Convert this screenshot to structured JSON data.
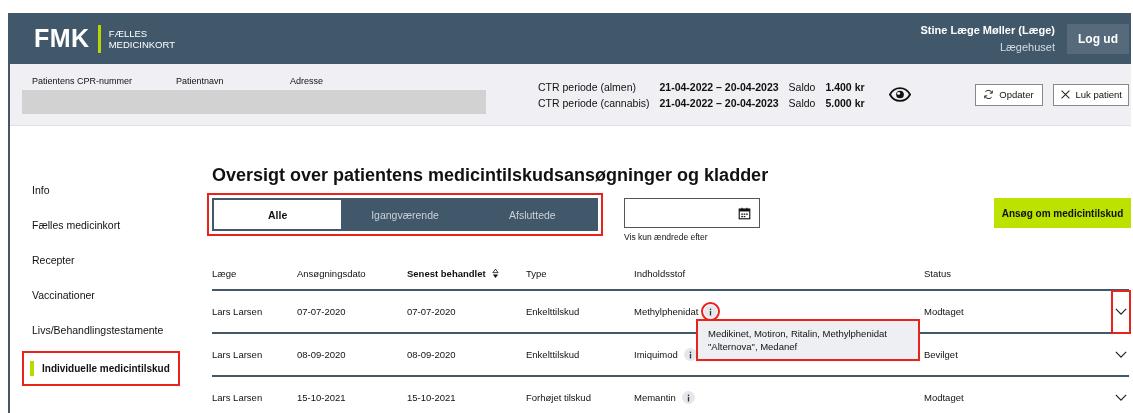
{
  "header": {
    "logo": "FMK",
    "subtitle_lines": [
      "FÆLLES",
      "MEDICINKORT"
    ],
    "user_name": "Stine Læge Møller (Læge)",
    "user_org": "Lægehuset",
    "logout": "Log ud"
  },
  "patient": {
    "labels": [
      "Patientens CPR-nummer",
      "Patientnavn",
      "Adresse"
    ],
    "periods": [
      {
        "label": "CTR periode (almen)",
        "period": "21-04-2022 – 20-04-2023",
        "saldo_label": "Saldo",
        "amount": "1.400 kr"
      },
      {
        "label": "CTR periode (cannabis)",
        "period": "21-04-2022 – 20-04-2023",
        "saldo_label": "Saldo",
        "amount": "5.000 kr"
      }
    ],
    "buttons": [
      {
        "kind": "refresh",
        "label": "Opdater"
      },
      {
        "kind": "close",
        "label": "Luk patient"
      }
    ]
  },
  "sidebar": {
    "items": [
      {
        "label": "Info",
        "selected": false,
        "annotated": false
      },
      {
        "label": "Fælles medicinkort",
        "selected": false,
        "annotated": false
      },
      {
        "label": "Recepter",
        "selected": false,
        "annotated": false
      },
      {
        "label": "Vaccinationer",
        "selected": false,
        "annotated": false
      },
      {
        "label": "Livs/Behandlingstestamente",
        "selected": false,
        "annotated": false
      },
      {
        "label": "Individuelle medicintilskud",
        "selected": true,
        "annotated": true
      }
    ]
  },
  "heading": "Oversigt over patientens medicintilskudsansøgninger og kladder",
  "filter_tabs": {
    "annotated": true,
    "tabs": [
      {
        "label": "Alle",
        "selected": true
      },
      {
        "label": "Igangværende",
        "selected": false
      },
      {
        "label": "Afsluttede",
        "selected": false
      }
    ]
  },
  "date_filter": {
    "hint": "Vis kun ændrede efter"
  },
  "apply_button": "Ansøg om medicintilskud",
  "table": {
    "columns": [
      {
        "label": "Læge",
        "sorted": false
      },
      {
        "label": "Ansøgningsdato",
        "sorted": false
      },
      {
        "label": "Senest behandlet",
        "sorted": true
      },
      {
        "label": "Type",
        "sorted": false
      },
      {
        "label": "Indholdsstof",
        "sorted": false
      },
      {
        "label": "Status",
        "sorted": false
      }
    ],
    "rows": [
      {
        "cells": [
          "Lars Larsen",
          "07-07-2020",
          "07-07-2020",
          "Enkelttilskud",
          "Methylphenidat"
        ],
        "status": "Modtaget",
        "info_annotated": true,
        "expand_annotated": true,
        "tooltip": {
          "text": "Medikinet, Motiron, Ritalin, Methylphenidat \"Alternova\", Medanef",
          "annotated": true
        }
      },
      {
        "cells": [
          "Lars Larsen",
          "08-09-2020",
          "08-09-2020",
          "Enkelttilskud",
          "Imiquimod"
        ],
        "status": "Bevilget",
        "info_annotated": false,
        "expand_annotated": false
      },
      {
        "cells": [
          "Lars Larsen",
          "15-10-2021",
          "15-10-2021",
          "Forhøjet tilskud",
          "Memantin"
        ],
        "status": "Modtaget",
        "info_annotated": false,
        "expand_annotated": false
      }
    ]
  }
}
